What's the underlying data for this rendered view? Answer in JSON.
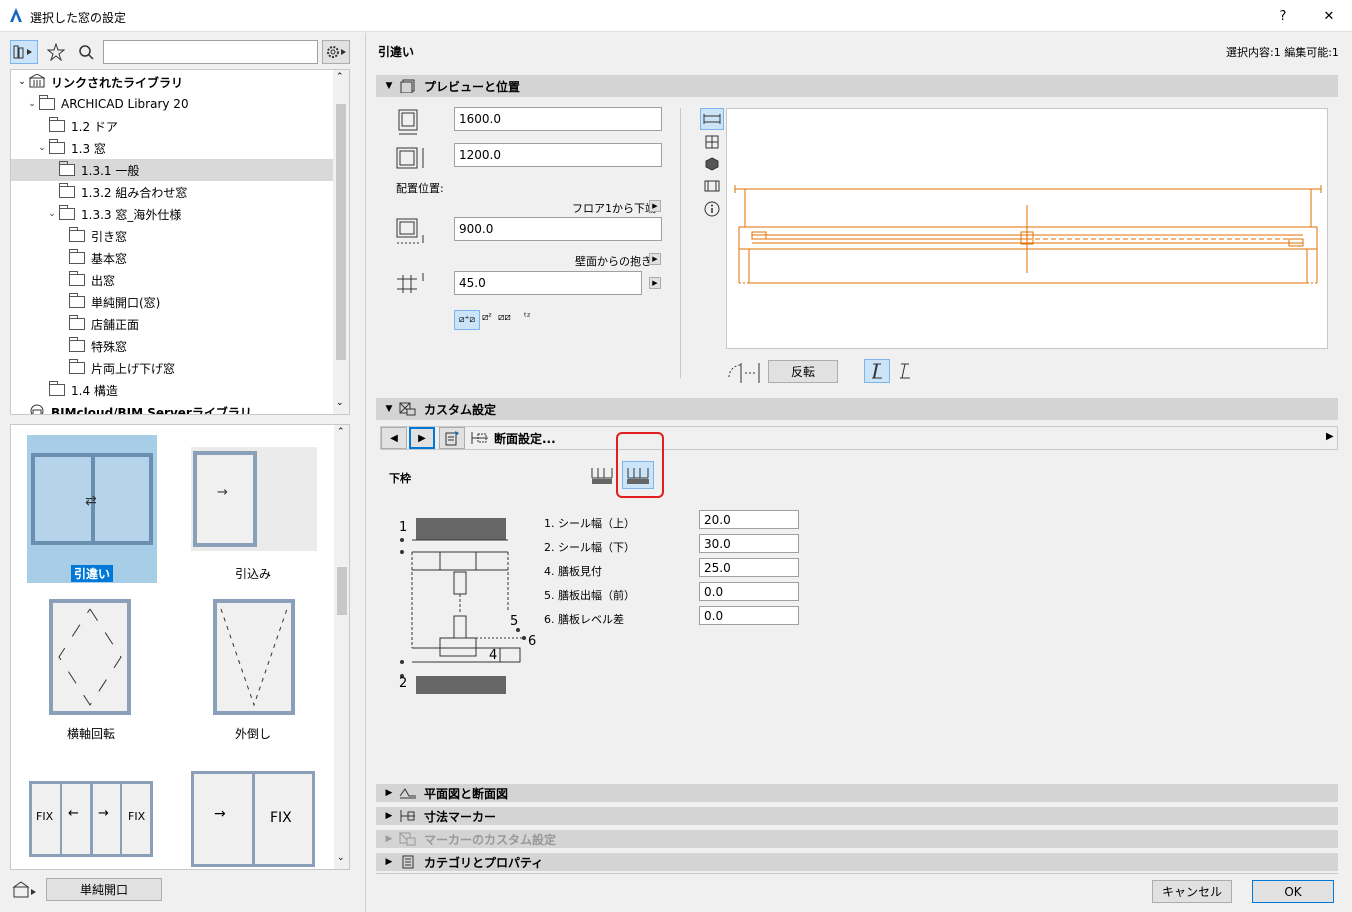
{
  "window": {
    "title": "選択した窓の設定",
    "help": "?",
    "close": "✕"
  },
  "toolbar": {
    "search_placeholder": ""
  },
  "tree": {
    "items": [
      {
        "label": "リンクされたライブラリ",
        "bold": true
      },
      {
        "label": "ARCHICAD Library 20"
      },
      {
        "label": "1.2 ドア"
      },
      {
        "label": "1.3 窓"
      },
      {
        "label": "1.3.1 一般"
      },
      {
        "label": "1.3.2 組み合わせ窓"
      },
      {
        "label": "1.3.3 窓_海外仕様"
      },
      {
        "label": "引き窓"
      },
      {
        "label": "基本窓"
      },
      {
        "label": "出窓"
      },
      {
        "label": "単純開口(窓)"
      },
      {
        "label": "店舗正面"
      },
      {
        "label": "特殊窓"
      },
      {
        "label": "片両上げ下げ窓"
      },
      {
        "label": "1.4 構造"
      },
      {
        "label": "BIMcloud/BIM Serverライブラリ",
        "bold": true
      }
    ]
  },
  "gallery": {
    "items": [
      {
        "label": "引違い"
      },
      {
        "label": "引込み"
      },
      {
        "label": "横軸回転"
      },
      {
        "label": "外倒し"
      },
      {
        "label": ""
      },
      {
        "label": ""
      }
    ],
    "fix_labels": [
      "FIX",
      "FIX",
      "FIX"
    ]
  },
  "bottom_left": {
    "button": "単純開口"
  },
  "header": {
    "object_name": "引違い",
    "selection_info": "選択内容:1 編集可能:1"
  },
  "preview_section": {
    "title": "プレビューと位置",
    "width_value": "1600.0",
    "height_value": "1200.0",
    "placement_label": "配置位置:",
    "floor_ref_label": "フロア1から下端",
    "sill_value": "900.0",
    "wall_ref_label": "壁面からの抱き",
    "reveal_value": "45.0",
    "flip_button": "反転"
  },
  "custom_section": {
    "title": "カスタム設定",
    "nav_label": "断面設定...",
    "subheading": "下枠",
    "params": [
      {
        "label": "1. シール幅（上）",
        "value": "20.0"
      },
      {
        "label": "2. シール幅（下）",
        "value": "30.0"
      },
      {
        "label": "4. 膳板見付",
        "value": "25.0"
      },
      {
        "label": "5. 膳板出幅（前）",
        "value": "0.0"
      },
      {
        "label": "6. 膳板レベル差",
        "value": "0.0"
      }
    ],
    "diagram_labels": [
      "1",
      "2",
      "4",
      "5",
      "6"
    ]
  },
  "sections": [
    {
      "title": "平面図と断面図",
      "enabled": true
    },
    {
      "title": "寸法マーカー",
      "enabled": true
    },
    {
      "title": "マーカーのカスタム設定",
      "enabled": false
    },
    {
      "title": "カテゴリとプロパティ",
      "enabled": true
    }
  ],
  "footer": {
    "cancel": "キャンセル",
    "ok": "OK"
  },
  "colors": {
    "accent": "#0078d7",
    "drawing": "#e07000",
    "highlight": "#e02020",
    "selected_bg": "#0078d7"
  }
}
